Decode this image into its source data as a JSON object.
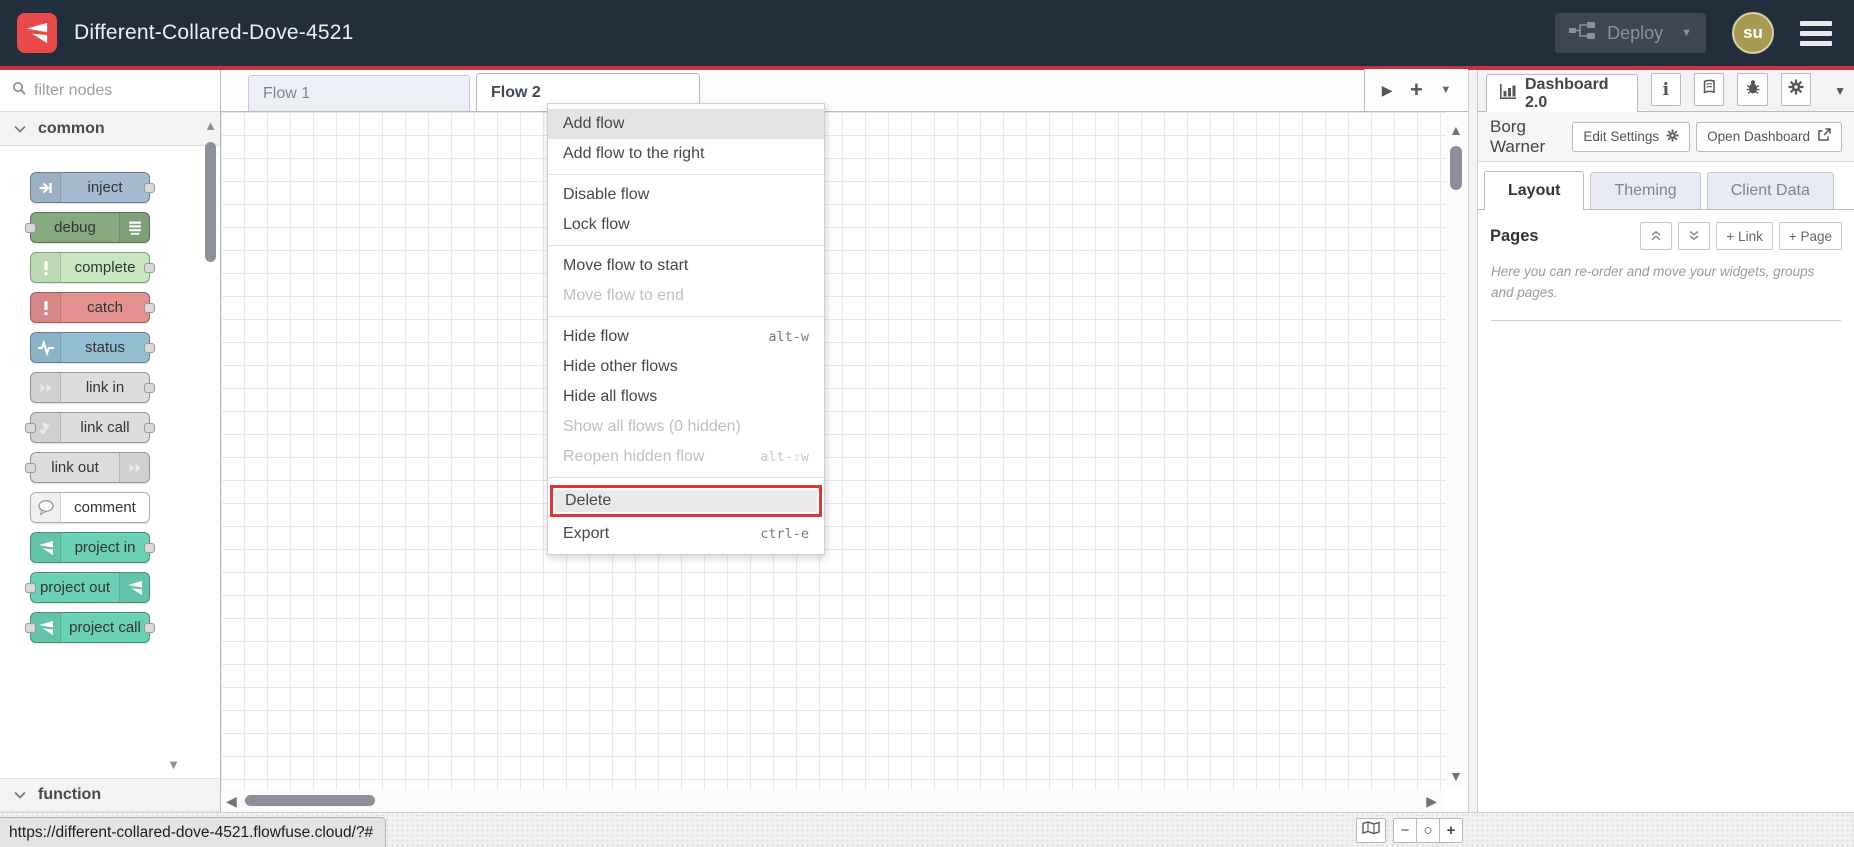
{
  "app": {
    "title": "Different-Collared-Dove-4521"
  },
  "header": {
    "deploy_label": "Deploy",
    "avatar_initials": "su"
  },
  "colors": {
    "header_bg": "#232e3c",
    "brand_red": "#e8494a",
    "accent_line": "#c8323f",
    "avatar_bg": "#a79a52",
    "danger_border": "#e23434",
    "teal_node": "#6bd1b6"
  },
  "icons": {
    "scroll_up": "▲",
    "scroll_down": "▼",
    "scroll_left": "◀",
    "scroll_right": "▶",
    "caret_down": "▼",
    "info": "i",
    "zoom_out": "−",
    "zoom_reset": "○",
    "zoom_in": "+",
    "plus": "+"
  },
  "palette": {
    "filter_placeholder": "filter nodes",
    "category_common": "common",
    "category_function": "function",
    "nodes": [
      {
        "label": "inject",
        "color": "#a6bbcf",
        "icon": "arrow-in",
        "icon_side": "left",
        "ports": [
          "right"
        ]
      },
      {
        "label": "debug",
        "color": "#87a980",
        "icon": "debug-list",
        "icon_side": "right",
        "ports": [
          "left"
        ]
      },
      {
        "label": "complete",
        "color": "#c8e7c0",
        "icon": "exclamation",
        "icon_side": "left",
        "ports": [
          "right"
        ]
      },
      {
        "label": "catch",
        "color": "#e49191",
        "icon": "exclamation",
        "icon_side": "left",
        "ports": [
          "right"
        ]
      },
      {
        "label": "status",
        "color": "#94bfd3",
        "icon": "pulse",
        "icon_side": "left",
        "ports": [
          "right"
        ]
      },
      {
        "label": "link in",
        "color": "#dddddd",
        "icon": "link-arrow",
        "icon_side": "left",
        "ports": [
          "right"
        ]
      },
      {
        "label": "link call",
        "color": "#dddddd",
        "icon": "link-call",
        "icon_side": "left",
        "ports": [
          "left",
          "right"
        ]
      },
      {
        "label": "link out",
        "color": "#dddddd",
        "icon": "link-arrow",
        "icon_side": "right",
        "ports": [
          "left"
        ]
      },
      {
        "label": "comment",
        "color": "#ffffff",
        "icon": "comment-bubble",
        "icon_side": "left",
        "ports": []
      },
      {
        "label": "project in",
        "color": "#6bd1b6",
        "icon": "ff-logo",
        "icon_side": "left",
        "ports": [
          "right"
        ]
      },
      {
        "label": "project out",
        "color": "#6bd1b6",
        "icon": "ff-logo",
        "icon_side": "right",
        "ports": [
          "left"
        ]
      },
      {
        "label": "project call",
        "color": "#6bd1b6",
        "icon": "ff-logo",
        "icon_side": "left",
        "ports": [
          "left",
          "right"
        ]
      }
    ]
  },
  "workspace": {
    "tabs": [
      {
        "label": "Flow 1",
        "active": false
      },
      {
        "label": "Flow 2",
        "active": true
      }
    ]
  },
  "context_menu": {
    "sections": [
      {
        "items": [
          {
            "label": "Add flow",
            "state": "hover"
          },
          {
            "label": "Add flow to the right"
          }
        ]
      },
      {
        "items": [
          {
            "label": "Disable flow"
          },
          {
            "label": "Lock flow"
          }
        ]
      },
      {
        "items": [
          {
            "label": "Move flow to start"
          },
          {
            "label": "Move flow to end",
            "disabled": true
          }
        ]
      },
      {
        "items": [
          {
            "label": "Hide flow",
            "shortcut": "alt-w"
          },
          {
            "label": "Hide other flows"
          },
          {
            "label": "Hide all flows"
          },
          {
            "label": "Show all flows (0 hidden)",
            "disabled": true
          },
          {
            "label": "Reopen hidden flow",
            "shortcut": "alt-⇧w",
            "disabled": true
          }
        ]
      },
      {
        "items": [
          {
            "label": "Delete",
            "state": "danger"
          },
          {
            "label": "Export",
            "shortcut": "ctrl-e"
          }
        ]
      }
    ]
  },
  "sidebar": {
    "tab_label": "Dashboard 2.0",
    "instance_label": "Borg Warner",
    "buttons": {
      "edit_settings": "Edit Settings",
      "open_dashboard": "Open Dashboard"
    },
    "tabs": [
      {
        "label": "Layout",
        "active": true
      },
      {
        "label": "Theming",
        "active": false
      },
      {
        "label": "Client Data",
        "active": false
      }
    ],
    "pages": {
      "title": "Pages",
      "link_button": "+ Link",
      "page_button": "+ Page",
      "help_text": "Here you can re-order and move your widgets, groups and pages."
    }
  },
  "status_bar": {
    "url": "https://different-collared-dove-4521.flowfuse.cloud/?#"
  }
}
